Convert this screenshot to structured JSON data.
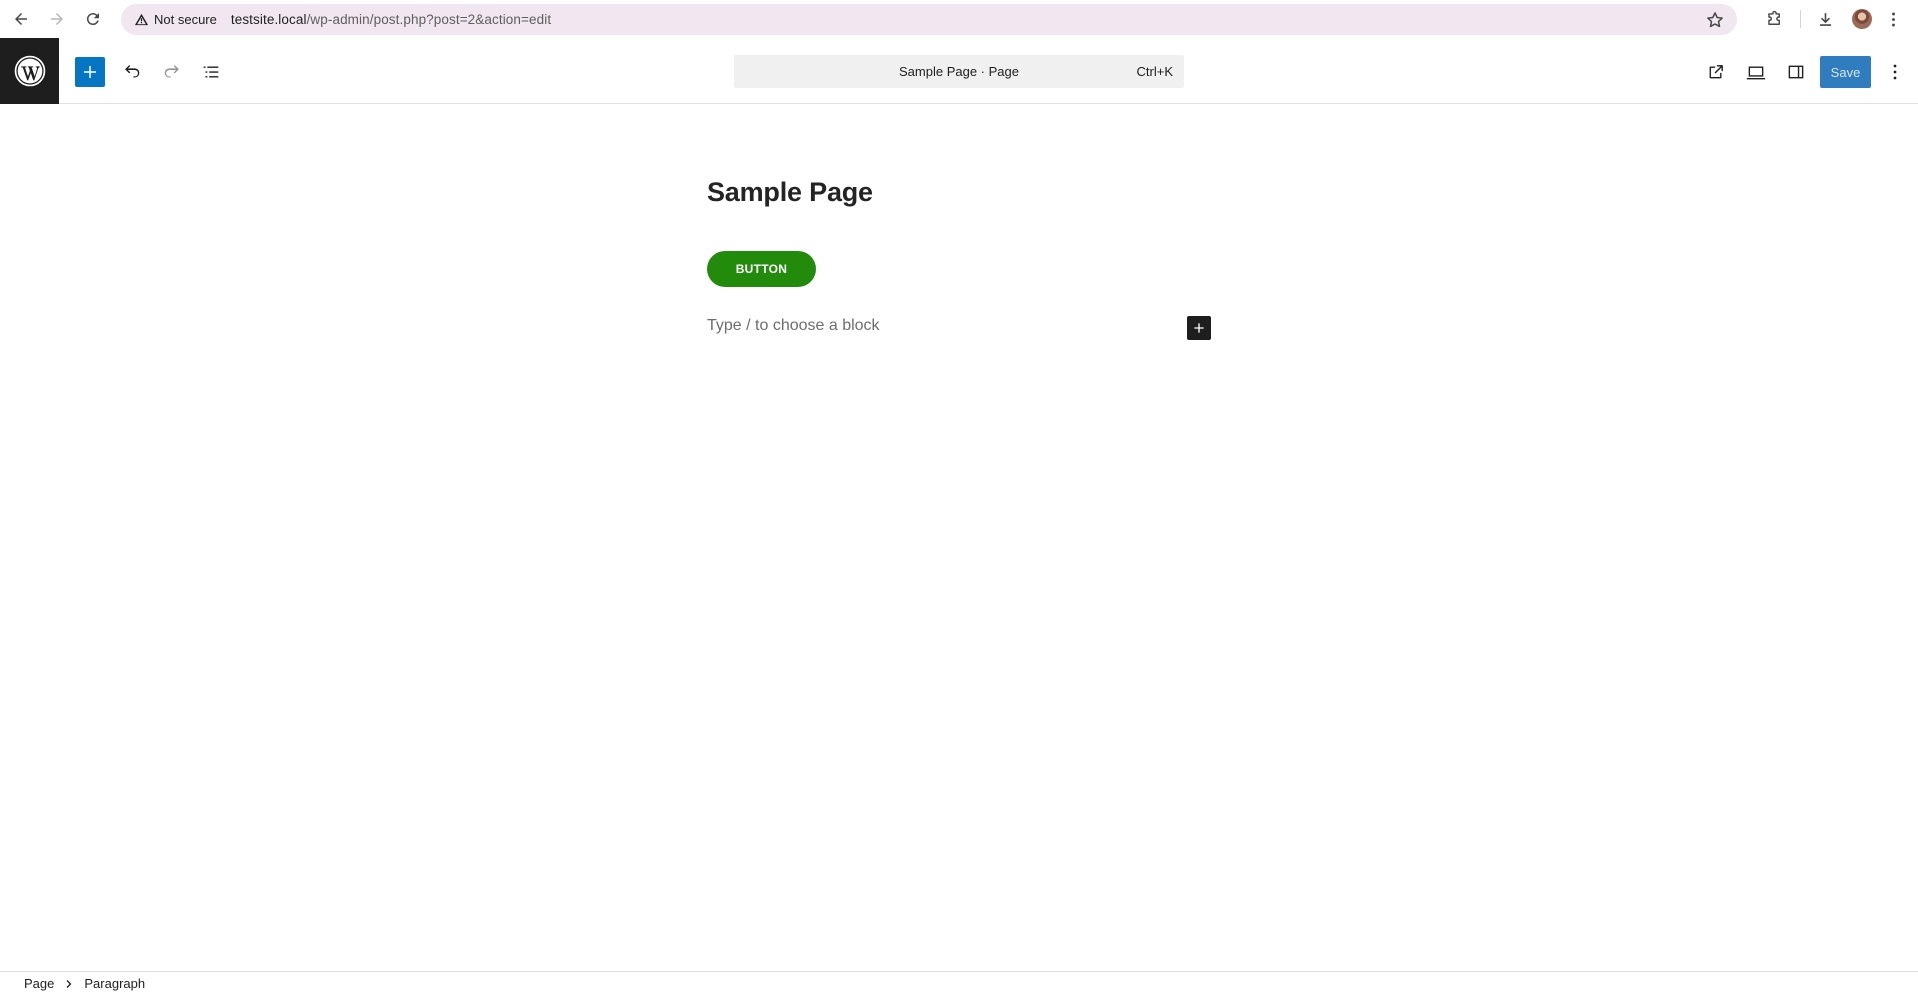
{
  "browser": {
    "security_label": "Not secure",
    "url_host": "testsite.local",
    "url_path": "/wp-admin/post.php?post=2&action=edit"
  },
  "editor_header": {
    "command_bar_title": "Sample Page · Page",
    "command_bar_shortcut": "Ctrl+K",
    "save_label": "Save"
  },
  "canvas": {
    "post_title": "Sample Page",
    "button_label": "BUTTON",
    "paragraph_placeholder": "Type / to choose a block"
  },
  "footer": {
    "breadcrumb": [
      "Page",
      "Paragraph"
    ]
  },
  "colors": {
    "wp_blue": "#0675c4",
    "button_green": "#238b0c",
    "omnibox_bg": "#f1e7f1",
    "logo_bg": "#1e1e1e"
  }
}
